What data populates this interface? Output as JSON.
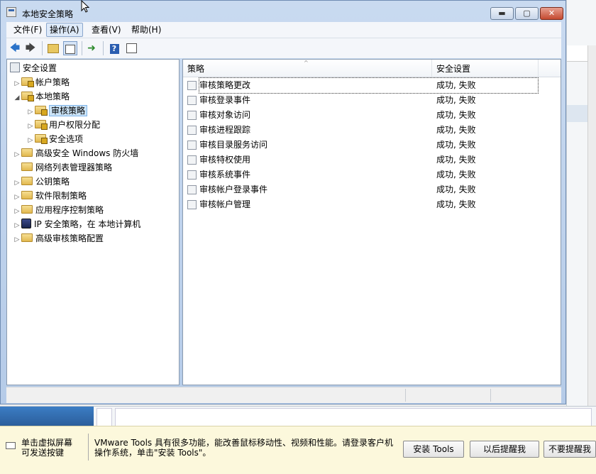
{
  "window": {
    "title": "本地安全策略",
    "controls": {
      "minimize": "▬",
      "maximize": "▢",
      "close": "✕"
    }
  },
  "menubar": {
    "items": [
      {
        "label": "文件(F)"
      },
      {
        "label": "操作(A)"
      },
      {
        "label": "查看(V)"
      },
      {
        "label": "帮助(H)"
      }
    ]
  },
  "toolbar": {
    "icons": [
      "back-icon",
      "forward-icon",
      "up-folder-icon",
      "show-hide-tree-icon",
      "export-list-icon",
      "help-icon",
      "properties-icon"
    ],
    "back": "🡄",
    "forward": "🡆",
    "export": "➜",
    "help": "?"
  },
  "tree": {
    "root": "安全设置",
    "items": [
      {
        "label": "帐户策略",
        "expander": "▷"
      },
      {
        "label": "本地策略",
        "expander": "◢"
      },
      {
        "label": "审核策略",
        "expander": "▷"
      },
      {
        "label": "用户权限分配",
        "expander": "▷"
      },
      {
        "label": "安全选项",
        "expander": "▷"
      },
      {
        "label": "高级安全 Windows 防火墙",
        "expander": "▷"
      },
      {
        "label": "网络列表管理器策略",
        "expander": ""
      },
      {
        "label": "公钥策略",
        "expander": "▷"
      },
      {
        "label": "软件限制策略",
        "expander": "▷"
      },
      {
        "label": "应用程序控制策略",
        "expander": "▷"
      },
      {
        "label": "IP 安全策略，在 本地计算机",
        "expander": "▷"
      },
      {
        "label": "高级审核策略配置",
        "expander": "▷"
      }
    ]
  },
  "list": {
    "columns": [
      "策略",
      "安全设置"
    ],
    "sort_indicator": "^",
    "rows": [
      {
        "policy": "审核策略更改",
        "setting": "成功, 失败"
      },
      {
        "policy": "审核登录事件",
        "setting": "成功, 失败"
      },
      {
        "policy": "审核对象访问",
        "setting": "成功, 失败"
      },
      {
        "policy": "审核进程跟踪",
        "setting": "成功, 失败"
      },
      {
        "policy": "审核目录服务访问",
        "setting": "成功, 失败"
      },
      {
        "policy": "审核特权使用",
        "setting": "成功, 失败"
      },
      {
        "policy": "审核系统事件",
        "setting": "成功, 失败"
      },
      {
        "policy": "审核帐户登录事件",
        "setting": "成功, 失败"
      },
      {
        "policy": "审核帐户管理",
        "setting": "成功, 失败"
      }
    ]
  },
  "vmware_bar": {
    "hint_line1": "单击虚拟屏幕",
    "hint_line2": "可发送按键",
    "message_line1": "VMware Tools 具有很多功能，能改善鼠标移动性、视频和性能。请登录客户机",
    "message_line2": "操作系统，单击\"安装 Tools\"。",
    "install_button": "安装 Tools",
    "later_button": "以后提醒我",
    "never_button": "不要提醒我"
  }
}
